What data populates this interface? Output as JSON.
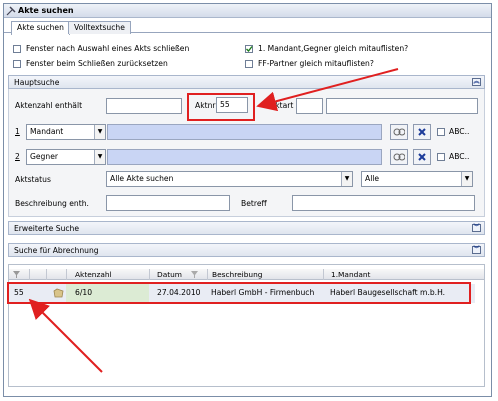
{
  "window": {
    "title": "Akte suchen"
  },
  "tabs": [
    {
      "label": "Akte suchen",
      "active": true
    },
    {
      "label": "Volltextsuche",
      "active": false
    }
  ],
  "options": {
    "close_after_select": {
      "label": "Fenster nach Auswahl eines Akts schließen",
      "checked": false
    },
    "reset_on_close": {
      "label": "Fenster beim Schließen zurücksetzen",
      "checked": false
    },
    "list_mandant_gegner": {
      "label": "1. Mandant,Gegner gleich mitauflisten?",
      "checked": true
    },
    "list_ff_partner": {
      "label": "FF-Partner gleich mitauflisten?",
      "checked": false
    }
  },
  "hauptsuche": {
    "header": "Hauptsuche",
    "aktenzahl_label": "Aktenzahl enthält",
    "aktenzahl_value": "",
    "aktnr_label": "Aktnr",
    "aktnr_value": "55",
    "aktart_label": "Aktart",
    "aktart_value": "",
    "party1": {
      "num": "1",
      "role": "Mandant",
      "value": "",
      "abc_label": "ABC.."
    },
    "party2": {
      "num": "2",
      "role": "Gegner",
      "value": "",
      "abc_label": "ABC.."
    },
    "aktstatus_label": "Aktstatus",
    "aktstatus_value": "Alle Akte suchen",
    "aktstatus_value2": "Alle",
    "beschreibung_label": "Beschreibung enth.",
    "beschreibung_value": "",
    "betreff_label": "Betreff",
    "betreff_value": ""
  },
  "sections": {
    "erweiterte": "Erweiterte Suche",
    "abrechnung": "Suche für Abrechnung"
  },
  "grid": {
    "columns": [
      "Aktenzahl",
      "Datum",
      "Beschreibung",
      "1.Mandant"
    ],
    "rows": [
      {
        "id": "55",
        "aktenzahl": "6/10",
        "datum": "27.04.2010",
        "beschreibung": "Haberl GmbH - Firmenbuch",
        "mandant": "Haberl Baugesellschaft m.b.H."
      }
    ]
  },
  "annotation_color": "#e02020"
}
